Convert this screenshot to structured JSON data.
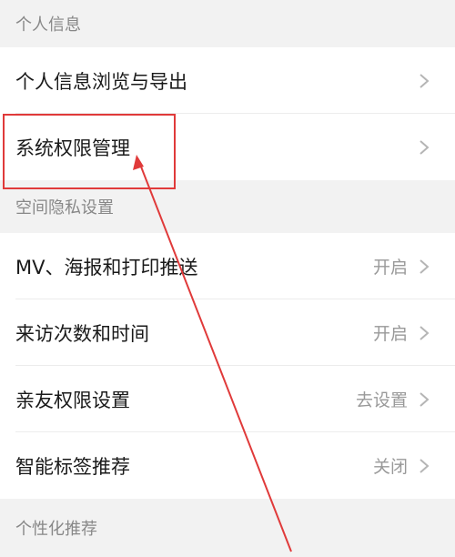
{
  "sections": [
    {
      "header": "个人信息",
      "rows": [
        {
          "label": "个人信息浏览与导出",
          "value": ""
        },
        {
          "label": "系统权限管理",
          "value": ""
        }
      ]
    },
    {
      "header": "空间隐私设置",
      "rows": [
        {
          "label": "MV、海报和打印推送",
          "value": "开启"
        },
        {
          "label": "来访次数和时间",
          "value": "开启"
        },
        {
          "label": "亲友权限设置",
          "value": "去设置"
        },
        {
          "label": "智能标签推荐",
          "value": "关闭"
        }
      ]
    },
    {
      "header": "个性化推荐",
      "rows": []
    }
  ],
  "icons": {
    "chevron": "chevron-right-icon"
  },
  "colors": {
    "background": "#f2f2f2",
    "row_background": "#ffffff",
    "annotation": "#e03a3a",
    "secondary_text": "#999999"
  }
}
